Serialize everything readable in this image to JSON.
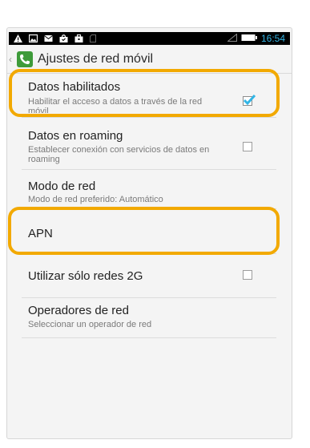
{
  "status_bar": {
    "time": "16:54",
    "left_icons": [
      "warning-icon",
      "picture-icon",
      "mail-icon",
      "shopping-bag-icon",
      "briefcase-icon",
      "sd-card-icon"
    ],
    "right_icons": [
      "signal-icon",
      "battery-icon"
    ]
  },
  "action_bar": {
    "title": "Ajustes de red móvil",
    "icon": "phone-icon"
  },
  "settings": [
    {
      "title": "Datos habilitados",
      "subtitle": "Habilitar el acceso a datos a través de la red móvil",
      "checkbox": true,
      "checked": true
    },
    {
      "title": "Datos en roaming",
      "subtitle": "Establecer conexión con servicios de datos en roaming",
      "checkbox": true,
      "checked": false
    },
    {
      "title": "Modo de red",
      "subtitle": "Modo de red preferido: Automático"
    },
    {
      "title": "APN"
    },
    {
      "title": "Utilizar sólo redes 2G",
      "checkbox": true,
      "checked": false
    },
    {
      "title": "Operadores de red",
      "subtitle": "Seleccionar un operador de red"
    }
  ],
  "colors": {
    "highlight": "#f2a900",
    "checkmark": "#33b5e5",
    "clock": "#33b5e5",
    "app_icon": "#3e9b3a"
  }
}
